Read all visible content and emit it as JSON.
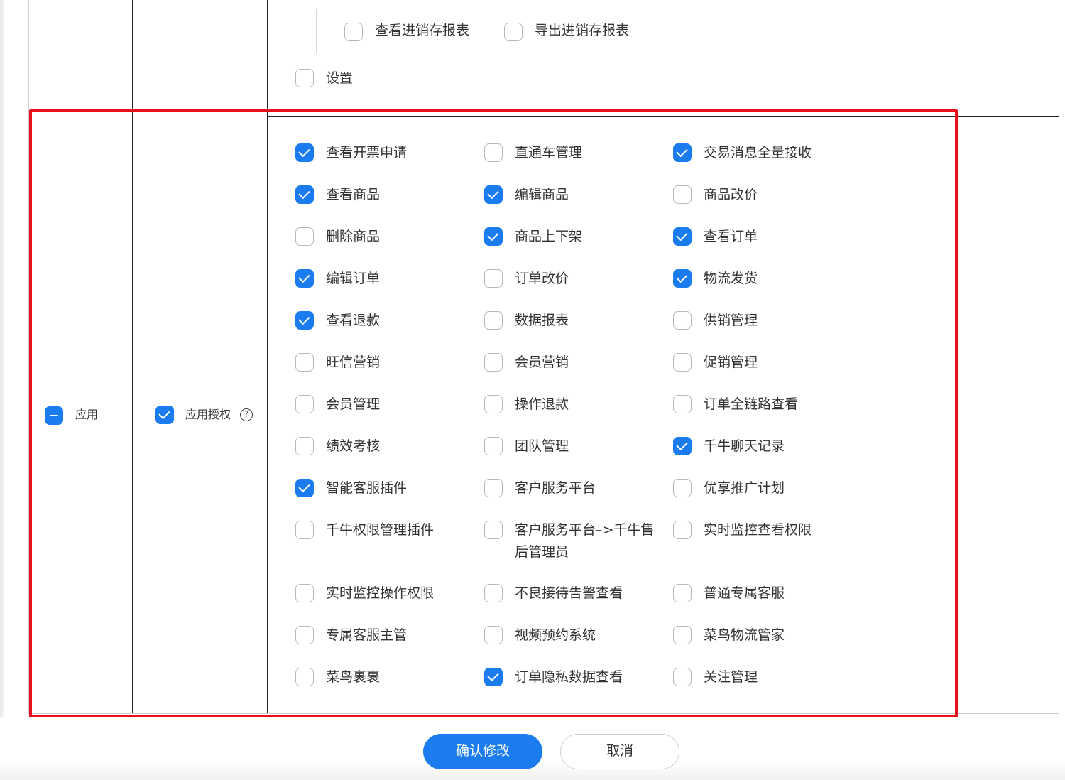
{
  "top_section": {
    "sub_items": [
      {
        "label": "查看进销存报表",
        "checked": false
      },
      {
        "label": "导出进销存报表",
        "checked": false
      }
    ],
    "settings": {
      "label": "设置",
      "checked": false
    }
  },
  "app_section": {
    "group_label": "应用",
    "group_state": "indeterminate",
    "sub_group_label": "应用授权",
    "sub_group_checked": true,
    "help_icon": "question-circle-icon",
    "permissions": [
      {
        "label": "查看开票申请",
        "checked": true
      },
      {
        "label": "直通车管理",
        "checked": false
      },
      {
        "label": "交易消息全量接收",
        "checked": true
      },
      {
        "label": "查看商品",
        "checked": true
      },
      {
        "label": "编辑商品",
        "checked": true
      },
      {
        "label": "商品改价",
        "checked": false
      },
      {
        "label": "删除商品",
        "checked": false
      },
      {
        "label": "商品上下架",
        "checked": true
      },
      {
        "label": "查看订单",
        "checked": true
      },
      {
        "label": "编辑订单",
        "checked": true
      },
      {
        "label": "订单改价",
        "checked": false
      },
      {
        "label": "物流发货",
        "checked": true
      },
      {
        "label": "查看退款",
        "checked": true
      },
      {
        "label": "数据报表",
        "checked": false
      },
      {
        "label": "供销管理",
        "checked": false
      },
      {
        "label": "旺信营销",
        "checked": false
      },
      {
        "label": "会员营销",
        "checked": false
      },
      {
        "label": "促销管理",
        "checked": false
      },
      {
        "label": "会员管理",
        "checked": false
      },
      {
        "label": "操作退款",
        "checked": false
      },
      {
        "label": "订单全链路查看",
        "checked": false
      },
      {
        "label": "绩效考核",
        "checked": false
      },
      {
        "label": "团队管理",
        "checked": false
      },
      {
        "label": "千牛聊天记录",
        "checked": true
      },
      {
        "label": "智能客服插件",
        "checked": true
      },
      {
        "label": "客户服务平台",
        "checked": false
      },
      {
        "label": "优享推广计划",
        "checked": false
      },
      {
        "label": "千牛权限管理插件",
        "checked": false
      },
      {
        "label": "客户服务平台–>千牛售后管理员",
        "checked": false
      },
      {
        "label": "实时监控查看权限",
        "checked": false
      },
      {
        "label": "实时监控操作权限",
        "checked": false
      },
      {
        "label": "不良接待告警查看",
        "checked": false
      },
      {
        "label": "普通专属客服",
        "checked": false
      },
      {
        "label": "专属客服主管",
        "checked": false
      },
      {
        "label": "视频预约系统",
        "checked": false
      },
      {
        "label": "菜鸟物流管家",
        "checked": false
      },
      {
        "label": "菜鸟裹裹",
        "checked": false
      },
      {
        "label": "订单隐私数据查看",
        "checked": true
      },
      {
        "label": "关注管理",
        "checked": false
      }
    ]
  },
  "footer": {
    "confirm_label": "确认修改",
    "cancel_label": "取消"
  },
  "colors": {
    "accent": "#1b7cf0",
    "highlight_border": "#e8101c"
  }
}
